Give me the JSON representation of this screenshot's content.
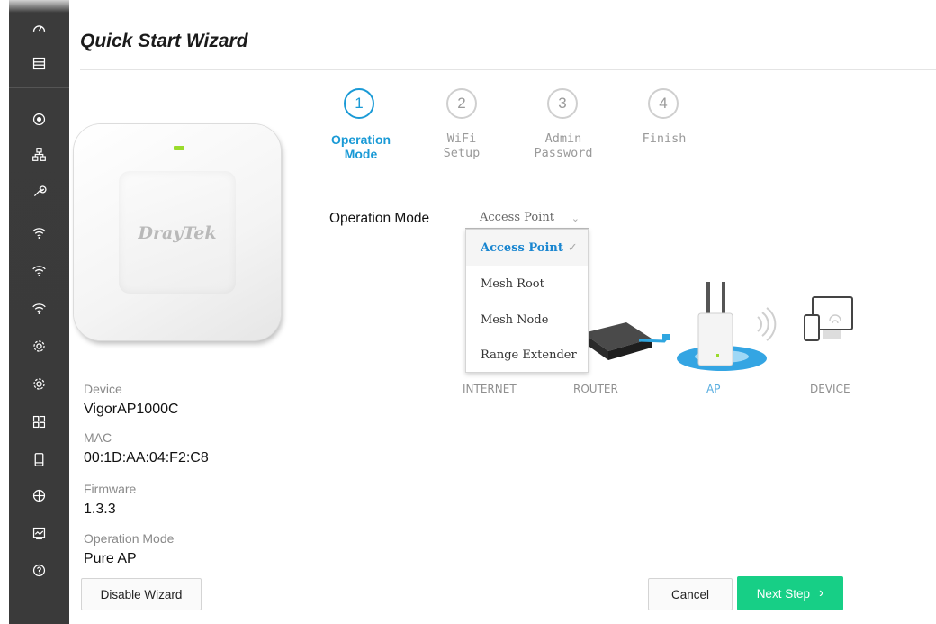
{
  "page": {
    "title": "Quick Start Wizard"
  },
  "sidebar": {
    "icons": [
      "dashboard-icon",
      "status-icon",
      "wizard-icon",
      "network-icon",
      "tools-icon",
      "wireless-icon",
      "wireless-icon",
      "wireless-icon",
      "settings-icon",
      "settings-icon",
      "apps-icon",
      "device-icon",
      "globe-icon",
      "monitor-icon",
      "help-icon"
    ]
  },
  "device_card": {
    "brand": "DrayTek",
    "info": [
      {
        "label": "Device",
        "value": "VigorAP1000C"
      },
      {
        "label": "MAC",
        "value": "00:1D:AA:04:F2:C8"
      },
      {
        "label": "Firmware",
        "value": "1.3.3"
      },
      {
        "label": "Operation Mode",
        "value": "Pure AP"
      }
    ]
  },
  "steps": [
    {
      "number": "1",
      "label_line1": "Operation",
      "label_line2": "Mode",
      "active": true
    },
    {
      "number": "2",
      "label_line1": "WiFi",
      "label_line2": "Setup",
      "active": false
    },
    {
      "number": "3",
      "label_line1": "Admin",
      "label_line2": "Password",
      "active": false
    },
    {
      "number": "4",
      "label_line1": "Finish",
      "label_line2": "",
      "active": false
    }
  ],
  "operation_mode": {
    "label": "Operation Mode",
    "selected": "Access Point",
    "options": [
      "Access Point",
      "Mesh Root",
      "Mesh Node",
      "Range Extender"
    ]
  },
  "diagram": {
    "labels": [
      "INTERNET",
      "ROUTER",
      "AP",
      "DEVICE"
    ]
  },
  "buttons": {
    "disable_wizard": "Disable Wizard",
    "cancel": "Cancel",
    "next_step": "Next Step",
    "next_icon": "chevron-right-icon"
  },
  "colors": {
    "accent": "#1a9ad6",
    "primary_button": "#17cf86",
    "sidebar": "#3a3a3a"
  }
}
